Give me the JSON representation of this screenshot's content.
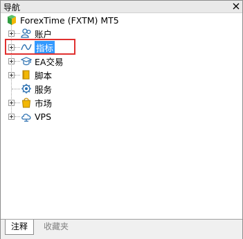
{
  "window": {
    "title": "导航"
  },
  "tree": {
    "root": {
      "label": "ForexTime (FXTM) MT5",
      "icon": "mt5-logo-icon"
    },
    "items": [
      {
        "label": "账户",
        "icon": "accounts-icon",
        "expandable": true
      },
      {
        "label": "指标",
        "icon": "indicator-icon",
        "expandable": true,
        "selected": true
      },
      {
        "label": "EA交易",
        "icon": "expert-advisor-icon",
        "expandable": true
      },
      {
        "label": "脚本",
        "icon": "script-icon",
        "expandable": true
      },
      {
        "label": "服务",
        "icon": "services-icon",
        "expandable": false
      },
      {
        "label": "市场",
        "icon": "market-icon",
        "expandable": true
      },
      {
        "label": "VPS",
        "icon": "vps-cloud-icon",
        "expandable": true
      }
    ]
  },
  "tabs": [
    {
      "label": "注释",
      "active": true
    },
    {
      "label": "收藏夹",
      "active": false
    }
  ],
  "colors": {
    "selection": "#3399ff",
    "highlight_box": "#e0302f"
  }
}
